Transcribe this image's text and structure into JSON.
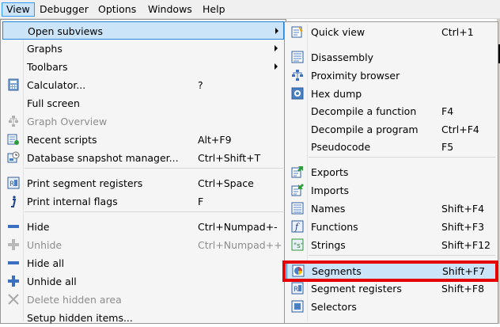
{
  "menubar": {
    "items": [
      {
        "label": "View",
        "key": "V"
      },
      {
        "label": "Debugger",
        "key": "D"
      },
      {
        "label": "Options",
        "key": "O"
      },
      {
        "label": "Windows",
        "key": "W"
      },
      {
        "label": "Help",
        "key": "H"
      }
    ]
  },
  "view_menu": {
    "items": [
      {
        "label": "Open subviews",
        "shortcut": "",
        "submenu": true,
        "highlighted": true,
        "disabled": false,
        "icon": "none"
      },
      {
        "label": "Graphs",
        "shortcut": "",
        "submenu": true,
        "highlighted": false,
        "disabled": false,
        "icon": "none"
      },
      {
        "label": "Toolbars",
        "shortcut": "",
        "submenu": true,
        "highlighted": false,
        "disabled": false,
        "icon": "none"
      },
      {
        "label": "Calculator...",
        "shortcut": "?",
        "submenu": false,
        "highlighted": false,
        "disabled": false,
        "icon": "calculator-icon"
      },
      {
        "label": "Full screen",
        "shortcut": "",
        "submenu": false,
        "highlighted": false,
        "disabled": false,
        "icon": "none"
      },
      {
        "label": "Graph Overview",
        "shortcut": "",
        "submenu": false,
        "highlighted": false,
        "disabled": true,
        "icon": "graph-overview-icon"
      },
      {
        "label": "Recent scripts",
        "shortcut": "Alt+F9",
        "submenu": false,
        "highlighted": false,
        "disabled": false,
        "icon": "recent-scripts-icon"
      },
      {
        "label": "Database snapshot manager...",
        "shortcut": "Ctrl+Shift+T",
        "submenu": false,
        "highlighted": false,
        "disabled": false,
        "icon": "snapshot-icon"
      },
      {
        "label": "Print segment registers",
        "shortcut": "Ctrl+Space",
        "submenu": false,
        "highlighted": false,
        "disabled": false,
        "icon": "segment-registers-icon"
      },
      {
        "label": "Print internal flags",
        "shortcut": "F",
        "submenu": false,
        "highlighted": false,
        "disabled": false,
        "icon": "info-icon"
      },
      {
        "label": "Hide",
        "shortcut": "Ctrl+Numpad+-",
        "submenu": false,
        "highlighted": false,
        "disabled": false,
        "icon": "minus-icon"
      },
      {
        "label": "Unhide",
        "shortcut": "Ctrl+Numpad++",
        "submenu": false,
        "highlighted": false,
        "disabled": true,
        "icon": "plus-icon"
      },
      {
        "label": "Hide all",
        "shortcut": "",
        "submenu": false,
        "highlighted": false,
        "disabled": false,
        "icon": "minus-icon"
      },
      {
        "label": "Unhide all",
        "shortcut": "",
        "submenu": false,
        "highlighted": false,
        "disabled": false,
        "icon": "plus-all-icon"
      },
      {
        "label": "Delete hidden area",
        "shortcut": "",
        "submenu": false,
        "highlighted": false,
        "disabled": true,
        "icon": "delete-x-icon"
      },
      {
        "label": "Setup hidden items...",
        "shortcut": "",
        "submenu": false,
        "highlighted": false,
        "disabled": false,
        "icon": "none"
      }
    ]
  },
  "subviews_menu": {
    "items": [
      {
        "label": "Quick view",
        "shortcut": "Ctrl+1",
        "highlighted": false,
        "icon": "quick-view-icon"
      },
      {
        "label": "Disassembly",
        "shortcut": "",
        "highlighted": false,
        "icon": "disassembly-icon"
      },
      {
        "label": "Proximity browser",
        "shortcut": "",
        "highlighted": false,
        "icon": "proximity-icon"
      },
      {
        "label": "Hex dump",
        "shortcut": "",
        "highlighted": false,
        "icon": "hex-dump-icon"
      },
      {
        "label": "Decompile a function",
        "shortcut": "F4",
        "highlighted": false,
        "icon": "none"
      },
      {
        "label": "Decompile a program",
        "shortcut": "Ctrl+F4",
        "highlighted": false,
        "icon": "none"
      },
      {
        "label": "Pseudocode",
        "shortcut": "F5",
        "highlighted": false,
        "icon": "none"
      },
      {
        "label": "Exports",
        "shortcut": "",
        "highlighted": false,
        "icon": "exports-icon"
      },
      {
        "label": "Imports",
        "shortcut": "",
        "highlighted": false,
        "icon": "imports-icon"
      },
      {
        "label": "Names",
        "shortcut": "Shift+F4",
        "highlighted": false,
        "icon": "names-icon"
      },
      {
        "label": "Functions",
        "shortcut": "Shift+F3",
        "highlighted": false,
        "icon": "functions-icon"
      },
      {
        "label": "Strings",
        "shortcut": "Shift+F12",
        "highlighted": false,
        "icon": "strings-icon"
      },
      {
        "label": "Segments",
        "shortcut": "Shift+F7",
        "highlighted": true,
        "icon": "segments-icon"
      },
      {
        "label": "Segment registers",
        "shortcut": "Shift+F8",
        "highlighted": false,
        "icon": "segment-registers-icon"
      },
      {
        "label": "Selectors",
        "shortcut": "",
        "highlighted": false,
        "icon": "selectors-icon"
      }
    ]
  },
  "colors": {
    "highlight_fill": "#cce4f7",
    "highlight_border": "#2684d9",
    "annotation_box": "#e60000",
    "disabled_text": "#8d8d8d"
  }
}
